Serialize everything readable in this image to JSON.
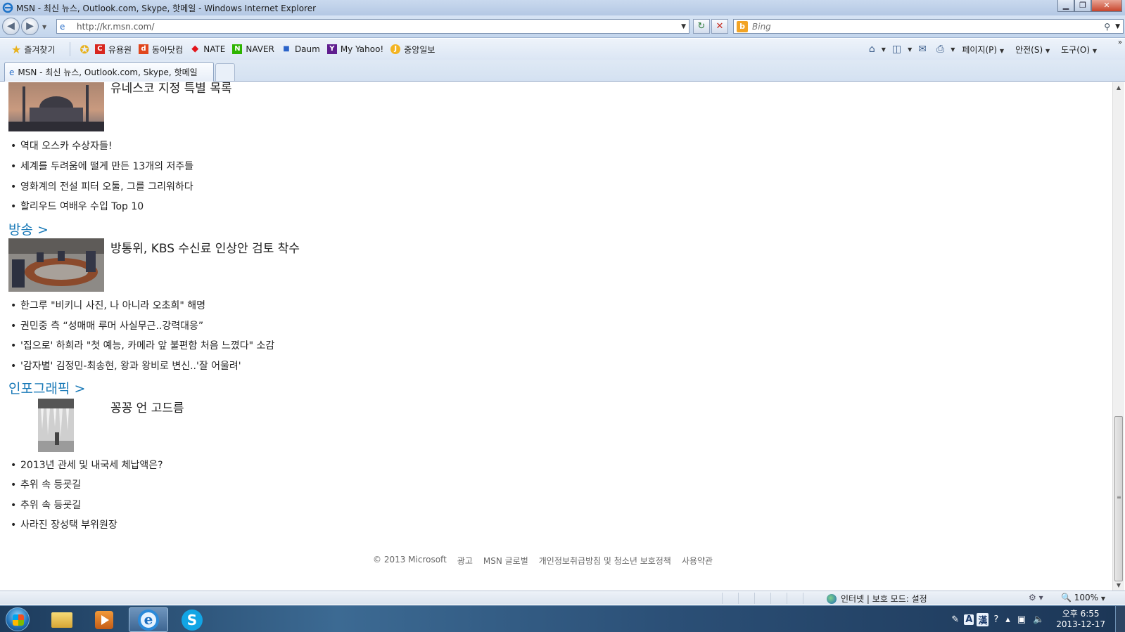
{
  "window": {
    "title": "MSN - 최신 뉴스, Outlook.com, Skype, 핫메일 - Windows Internet Explorer",
    "controls": {
      "minimize": "▁",
      "maximize": "❐",
      "close": "✕"
    }
  },
  "nav": {
    "back_glyph": "◀",
    "forward_glyph": "▶",
    "url": "http://kr.msn.com/",
    "refresh_glyph": "↻",
    "stop_glyph": "✕",
    "search_placeholder": "Bing"
  },
  "favorites": {
    "main_label": "즐겨찾기",
    "items": [
      {
        "label": "유용원",
        "icon": "C",
        "color": "#d8261f"
      },
      {
        "label": "동아닷컴",
        "icon": "d",
        "color": "#e0461d"
      },
      {
        "label": "NATE",
        "icon": "◆",
        "color": "#e3151b"
      },
      {
        "label": "NAVER",
        "icon": "N",
        "color": "#2db400"
      },
      {
        "label": "Daum",
        "icon": "■",
        "color": "#2b63c9"
      },
      {
        "label": "My Yahoo!",
        "icon": "Y",
        "color": "#5f1d8f"
      },
      {
        "label": "중앙일보",
        "icon": "J",
        "color": "#f3b422"
      }
    ],
    "commands": [
      "페이지(P)",
      "안전(S)",
      "도구(O)"
    ]
  },
  "tabs": [
    {
      "label": "MSN - 최신 뉴스, Outlook.com, Skype, 핫메일"
    }
  ],
  "content": {
    "top_headline": "유네스코 지정 특별 목록",
    "top_bullets": [
      "역대 오스카 수상자들!",
      "세계를 두려움에 떨게 만든 13개의 저주들",
      "영화계의 전설 피터 오툴, 그를 그리워하다",
      "할리우드 여배우 수입 Top 10"
    ],
    "sections": [
      {
        "heading": "방송 >",
        "headline": "방통위, KBS 수신료 인상안 검토 착수",
        "bullets": [
          "한그루 \"비키니 사진, 나 아니라 오초희\" 해명",
          "권민중 측 “성매매 루머 사실무근..강력대응”",
          "'집으로' 하희라 \"첫 예능, 카메라 앞 불편함 처음 느꼈다\" 소감",
          "'감자별' 김정민-최송현, 왕과 왕비로 변신..'잘 어울려'"
        ]
      },
      {
        "heading": "인포그래픽 >",
        "headline": "꽁꽁 언 고드름",
        "bullets": [
          "2013년 관세 및 내국세 체납액은?",
          "추위 속 등굣길",
          "추위 속 등굣길",
          "사라진 장성택 부위원장"
        ]
      }
    ],
    "footer_links": [
      "© 2013 Microsoft",
      "광고",
      "MSN 글로벌",
      "개인정보취급방침 및 청소년 보호정책",
      "사용약관"
    ]
  },
  "status": {
    "zone": "인터넷 | 보호 모드: 설정",
    "zoom": "100%"
  },
  "taskbar": {
    "tray_ime_a": "A",
    "tray_ime_han": "漢",
    "clock_time": "오후 6:55",
    "clock_date": "2013-12-17"
  }
}
